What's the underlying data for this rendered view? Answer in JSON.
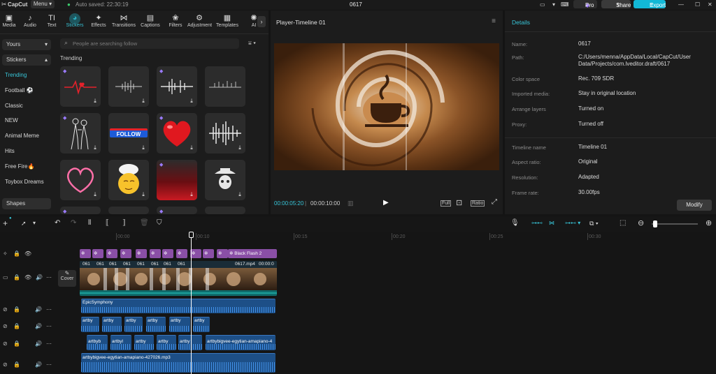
{
  "titlebar": {
    "app_name": "CapCut",
    "menu_label": "Menu",
    "autosave": "Auto saved: 22:30:19",
    "project_title": "0617",
    "pro_label": "Pro",
    "share_label": "Share",
    "export_label": "Export"
  },
  "toolbar": {
    "items": [
      {
        "label": "Media",
        "icon": "media-icon"
      },
      {
        "label": "Audio",
        "icon": "audio-icon"
      },
      {
        "label": "Text",
        "icon": "text-icon"
      },
      {
        "label": "Stickers",
        "icon": "stickers-icon"
      },
      {
        "label": "Effects",
        "icon": "effects-icon"
      },
      {
        "label": "Transitions",
        "icon": "transitions-icon"
      },
      {
        "label": "Captions",
        "icon": "captions-icon"
      },
      {
        "label": "Filters",
        "icon": "filters-icon"
      },
      {
        "label": "Adjustment",
        "icon": "adjustment-icon"
      },
      {
        "label": "Templates",
        "icon": "templates-icon"
      },
      {
        "label": "AI",
        "icon": "ai-icon"
      }
    ]
  },
  "sidebar": {
    "yours_label": "Yours",
    "stickers_label": "Stickers",
    "items": [
      "Trending",
      "Football",
      "Classic",
      "NEW",
      "Animal Meme",
      "Hits",
      "Free Fire",
      "Toybox Dreams"
    ],
    "shapes_label": "Shapes"
  },
  "stickers": {
    "search_placeholder": "People are searching follow",
    "section_title": "Trending",
    "follow_label": "FOLLOW"
  },
  "player": {
    "title": "Player-Timeline 01",
    "current_time": "00:00:05:20",
    "total_time": "00:00:10:00",
    "full_label": "Full",
    "ratio_label": "Ratio"
  },
  "details": {
    "title": "Details",
    "rows": [
      {
        "key": "Name:",
        "value": "0617"
      },
      {
        "key": "Path:",
        "value": "C:/Users/menna/AppData/Local/CapCut/User Data/Projects/com.lveditor.draft/0617"
      },
      {
        "key": "Color space",
        "value": "Rec. 709 SDR"
      },
      {
        "key": "Imported media:",
        "value": "Stay in original location"
      },
      {
        "key": "Arrange layers",
        "value": "Turned on"
      },
      {
        "key": "Proxy:",
        "value": "Turned off"
      },
      {
        "key": "Timeline name",
        "value": "Timeline 01"
      },
      {
        "key": "Aspect ratio:",
        "value": "Original"
      },
      {
        "key": "Resolution:",
        "value": "Adapted"
      },
      {
        "key": "Frame rate:",
        "value": "30.00fps"
      }
    ],
    "modify_label": "Modify"
  },
  "timeline": {
    "ticks": [
      "00:00",
      "00:10",
      "00:15",
      "00:20",
      "00:25",
      "00:30"
    ],
    "cover_label": "Cover",
    "effect_clip": "Black Flash 2",
    "video_clip_labels": [
      "061",
      "061",
      "061",
      "061",
      "061",
      "061",
      "061",
      "061",
      "0617.mp4",
      "00:00:0"
    ],
    "audio_track1": "EpicSymphony",
    "audio_track2_clips": [
      "artby",
      "artby",
      "artby",
      "artby",
      "artby",
      "artby"
    ],
    "audio_track3_clips": [
      "artbyb",
      "artbyl",
      "artby",
      "artby",
      "artby",
      "artbybigvee-egytian-amapiano-4"
    ],
    "audio_track4": "artbybigvee-egytian-amapiano-427026.mp3"
  },
  "colors": {
    "accent": "#38c6d9",
    "export_bg": "#12b8d6",
    "effect_purple": "#8a4fa6",
    "audio_blue": "#1d4f87"
  }
}
